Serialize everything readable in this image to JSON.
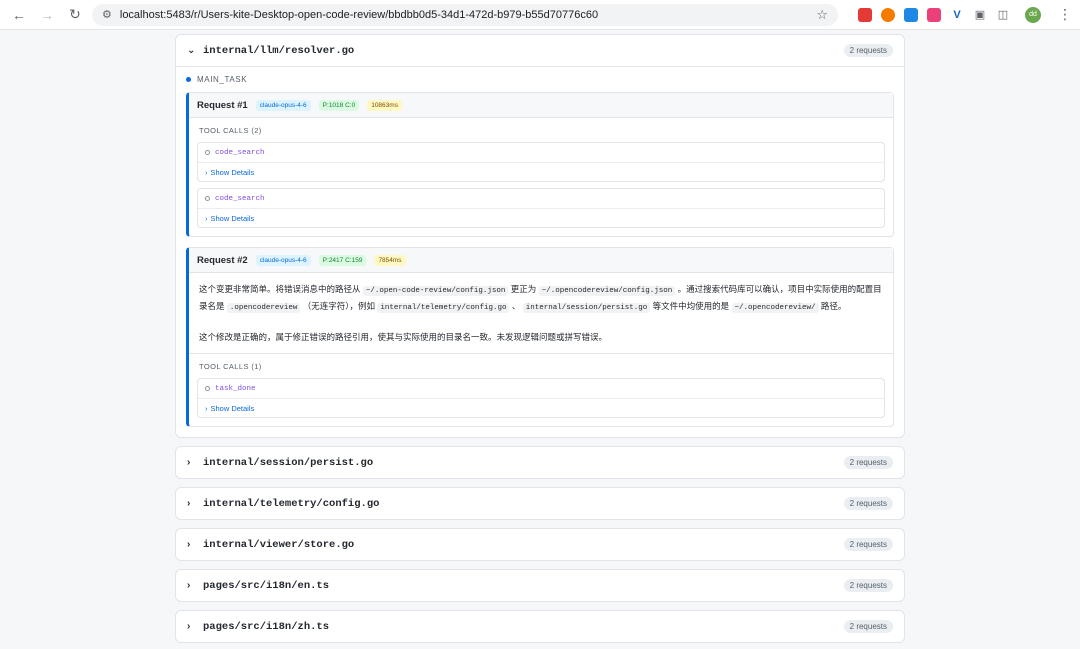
{
  "browser": {
    "url": "localhost:5483/r/Users-kite-Desktop-open-code-review/bbdbb0d5-34d1-472d-b979-b55d70776c60",
    "avatar_text": "dd"
  },
  "files": [
    {
      "name": "internal/llm/resolver.go",
      "count": "2 requests",
      "expanded": true
    },
    {
      "name": "internal/session/persist.go",
      "count": "2 requests"
    },
    {
      "name": "internal/telemetry/config.go",
      "count": "2 requests"
    },
    {
      "name": "internal/viewer/store.go",
      "count": "2 requests"
    },
    {
      "name": "pages/src/i18n/en.ts",
      "count": "2 requests"
    },
    {
      "name": "pages/src/i18n/zh.ts",
      "count": "2 requests"
    }
  ],
  "task_label": "MAIN_TASK",
  "requests": [
    {
      "title": "Request #1",
      "model": "claude-opus-4-6",
      "tokens": "P:1018 C:0",
      "time": "10863ms",
      "tool_calls_title": "TOOL CALLS (2)",
      "tool_calls": [
        {
          "name": "code_search",
          "details": "Show Details"
        },
        {
          "name": "code_search",
          "details": "Show Details"
        }
      ]
    },
    {
      "title": "Request #2",
      "model": "claude-opus-4-6",
      "tokens": "P:2417 C:159",
      "time": "7854ms",
      "text": {
        "p1_a": "这个变更非常简单。将错误消息中的路径从",
        "code1": "~/.open-code-review/config.json",
        "p1_b": "更正为",
        "code2": "~/.opencodereview/config.json",
        "p1_c": "。通过搜索代码库可以确认，项目中实际使用的配置目录名是",
        "code3": ".opencodereview",
        "p1_d": "（无连字符），例如",
        "code4": "internal/telemetry/config.go",
        "p1_e": "、",
        "code5": "internal/session/persist.go",
        "p1_f": "等文件中均使用的是",
        "code6": "~/.opencodereview/",
        "p1_g": "路径。",
        "p2": "这个修改是正确的，属于修正错误的路径引用，使其与实际使用的目录名一致。未发现逻辑问题或拼写错误。"
      },
      "tool_calls_title": "TOOL CALLS (1)",
      "tool_calls": [
        {
          "name": "task_done",
          "details": "Show Details"
        }
      ]
    }
  ]
}
